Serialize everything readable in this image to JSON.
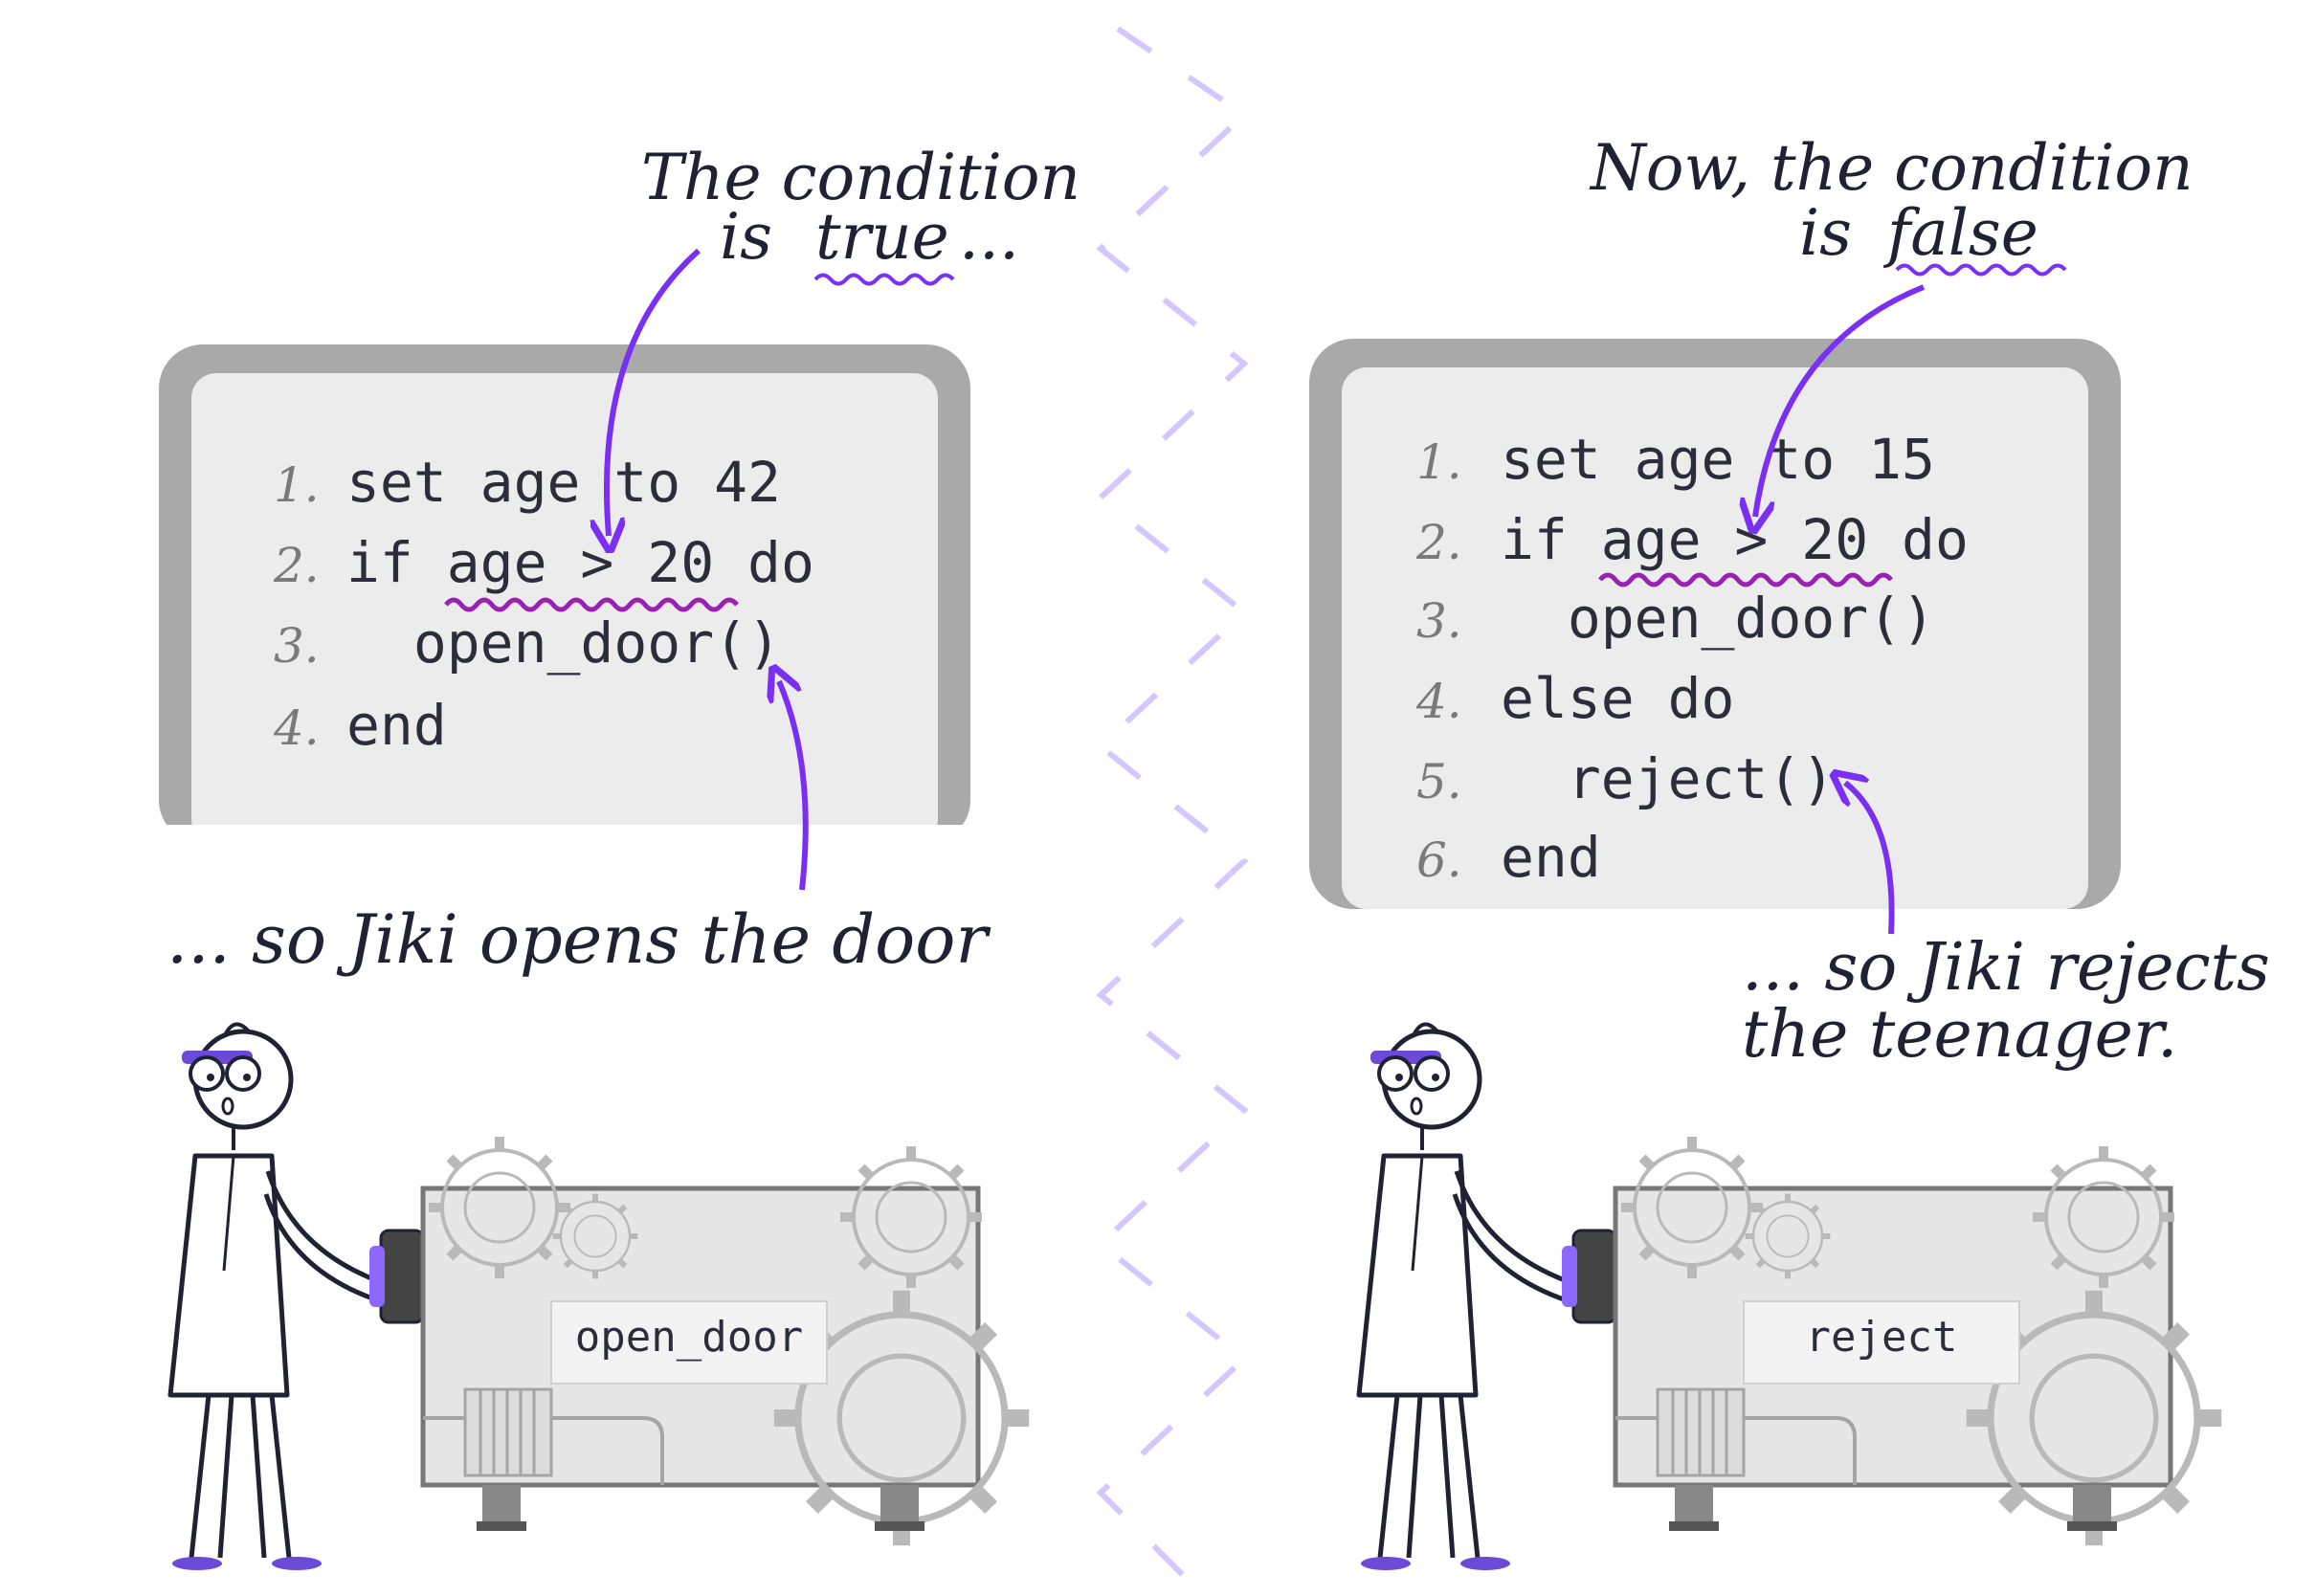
{
  "panels": [
    {
      "id": "true-case",
      "code": [
        {
          "num": "1.",
          "text": "set age to 42"
        },
        {
          "num": "2.",
          "text": "if age > 20 do"
        },
        {
          "num": "3.",
          "text": "  open_door()"
        },
        {
          "num": "4.",
          "text": "end"
        }
      ],
      "note_top_line1": "The condition",
      "note_top_line2_prefix": "is",
      "note_top_keyword": "true",
      "note_top_suffix": "...",
      "note_bottom_line1": "... so Jiki opens the door",
      "note_bottom_line2": "",
      "machine_label": "open_door"
    },
    {
      "id": "false-case",
      "code": [
        {
          "num": "1.",
          "text": "set age to 15"
        },
        {
          "num": "2.",
          "text": "if age > 20 do"
        },
        {
          "num": "3.",
          "text": "  open_door()"
        },
        {
          "num": "4.",
          "text": "else do"
        },
        {
          "num": "5.",
          "text": "  reject()"
        },
        {
          "num": "6.",
          "text": "end"
        }
      ],
      "note_top_line1": "Now, the condition",
      "note_top_line2_prefix": "is",
      "note_top_keyword": "false",
      "note_top_suffix": "",
      "note_bottom_line1": "... so Jiki rejects",
      "note_bottom_line2": "the teenager.",
      "machine_label": "reject"
    }
  ],
  "colors": {
    "accent": "#7b2ff2",
    "squiggle": "#9b1fb5",
    "divider": "#c9b8ff",
    "board_frame": "#a9a9a9",
    "board_surface": "#ececec",
    "machine_body": "#e6e6e6"
  }
}
